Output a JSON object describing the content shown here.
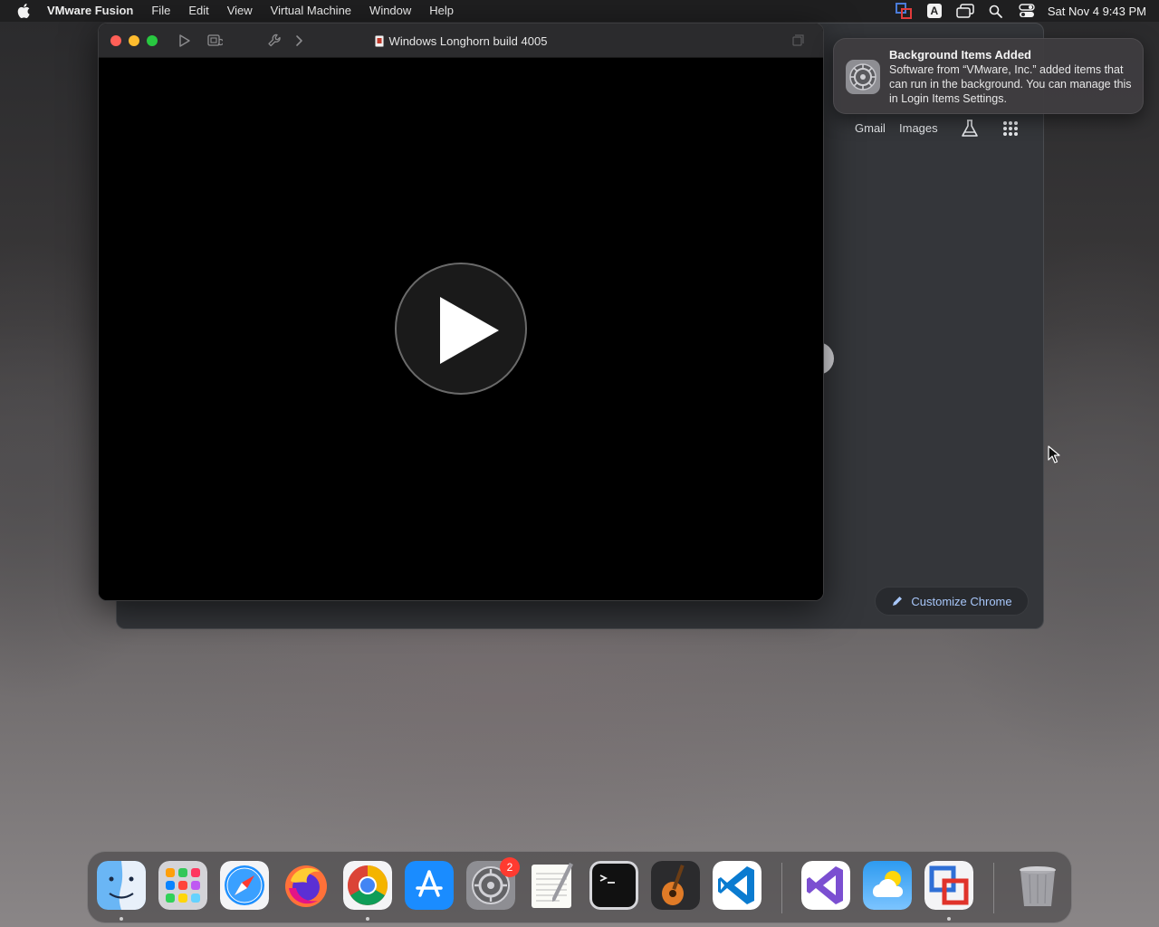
{
  "menubar": {
    "app_name": "VMware Fusion",
    "items": [
      "File",
      "Edit",
      "View",
      "Virtual Machine",
      "Window",
      "Help"
    ],
    "status_icons": [
      "vmware-fusion-status-icon",
      "input-source-icon",
      "screen-mirroring-icon",
      "spotlight-search-icon",
      "control-center-icon"
    ],
    "input_source_label": "A",
    "clock": "Sat Nov 4  9:43 PM"
  },
  "vm_window": {
    "title": "Windows Longhorn build 4005",
    "state": "powered-off",
    "play_icon": "play-icon"
  },
  "chrome_window": {
    "links": {
      "gmail": "Gmail",
      "images": "Images"
    },
    "labs_icon": "labs-flask-icon",
    "apps_icon": "google-apps-grid-icon",
    "customize_label": "Customize Chrome"
  },
  "notification": {
    "title": "Background Items Added",
    "body": "Software from “VMware, Inc.” added items that can run in the background. You can manage this in Login Items Settings.",
    "icon": "system-settings-gear-icon"
  },
  "dock": {
    "apps": [
      {
        "name": "Finder",
        "icon": "finder-icon",
        "running": true
      },
      {
        "name": "Launchpad",
        "icon": "launchpad-icon",
        "running": false
      },
      {
        "name": "Safari",
        "icon": "safari-icon",
        "running": false
      },
      {
        "name": "Firefox",
        "icon": "firefox-icon",
        "running": false
      },
      {
        "name": "Google Chrome",
        "icon": "chrome-icon",
        "running": true
      },
      {
        "name": "App Store",
        "icon": "app-store-icon",
        "running": false
      },
      {
        "name": "System Settings",
        "icon": "system-settings-icon",
        "running": false,
        "badge": "2"
      },
      {
        "name": "TextEdit",
        "icon": "textedit-icon",
        "running": false
      },
      {
        "name": "Terminal",
        "icon": "terminal-icon",
        "running": false
      },
      {
        "name": "GarageBand",
        "icon": "garageband-icon",
        "running": false
      },
      {
        "name": "Visual Studio Code",
        "icon": "vscode-icon",
        "running": false
      },
      {
        "name": "Visual Studio",
        "icon": "visual-studio-icon",
        "running": false
      },
      {
        "name": "Weather",
        "icon": "weather-icon",
        "running": false
      },
      {
        "name": "VMware Fusion",
        "icon": "vmware-fusion-icon",
        "running": true
      },
      {
        "name": "Trash",
        "icon": "trash-icon",
        "running": false
      }
    ],
    "badge_count": "2"
  },
  "colors": {
    "close": "#ff5f57",
    "minimize": "#febc2e",
    "maximize": "#28c840",
    "badge": "#ff3b30",
    "chrome_accent": "#a8c7fa"
  }
}
